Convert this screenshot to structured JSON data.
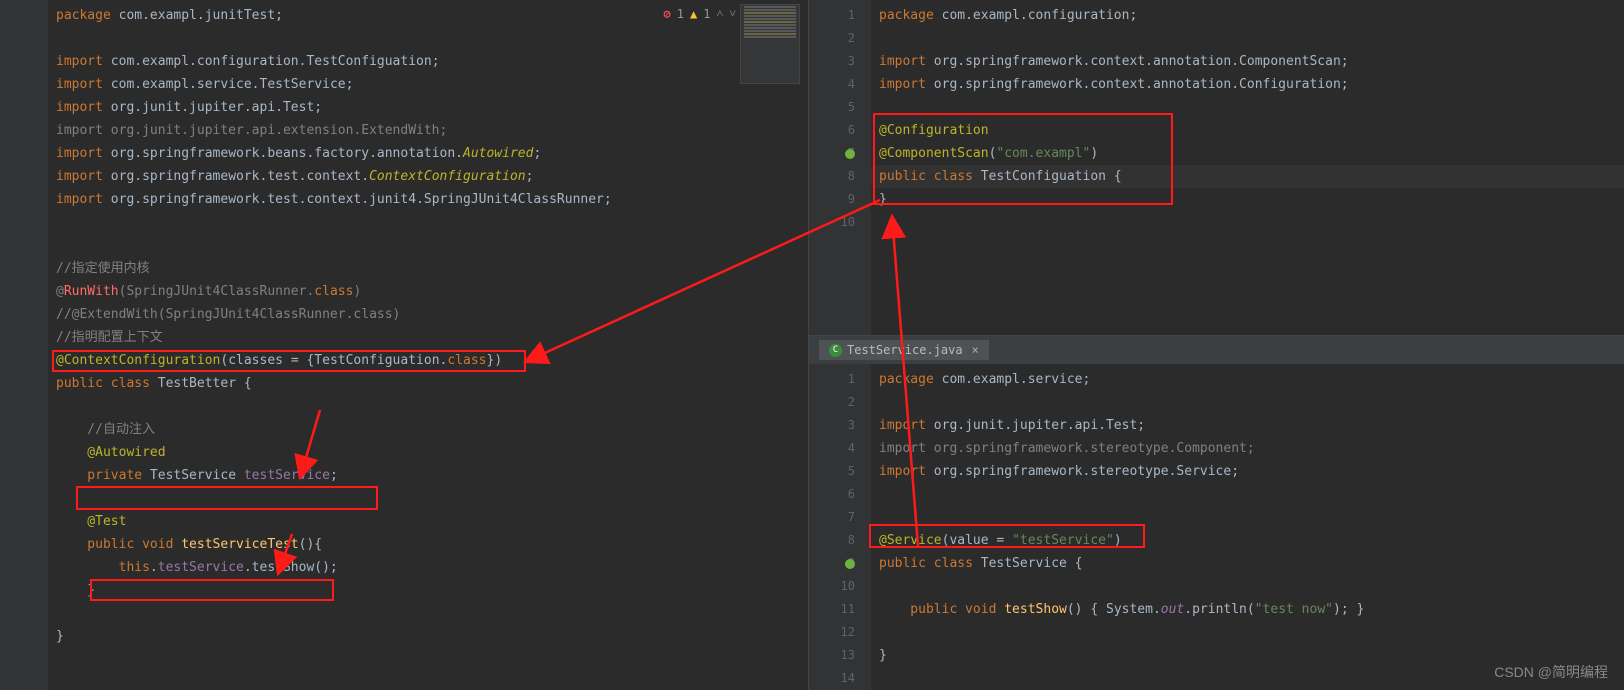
{
  "inspections": {
    "errors": "1",
    "warnings": "1"
  },
  "left": {
    "l1_kw1": "package",
    "l1_pkg": " com.exampl.junitTest;",
    "l3_kw": "import",
    "l3a": " com.exampl.configuration.TestConfiguation;",
    "l4_kw": "import",
    "l4a": " com.exampl.service.TestService;",
    "l5_kw": "import",
    "l5a": " org.junit.jupiter.api.Test;",
    "l6": "import org.junit.jupiter.api.extension.ExtendWith;",
    "l7_kw": "import",
    "l7a": " org.springframework.beans.factory.annotation.",
    "l7b": "Autowired",
    "l7c": ";",
    "l8_kw": "import",
    "l8a": " org.springframework.test.context.",
    "l8b": "ContextConfiguration",
    "l8c": ";",
    "l9_kw": "import",
    "l9a": " org.springframework.test.context.junit4.SpringJUnit4ClassRunner;",
    "c1": "//指定使用内核",
    "r1a": "@",
    "r1b": "RunWith",
    "r1c": "(SpringJUnit4ClassRunner.",
    "r1d": "class",
    "r1e": ")",
    "c2": "//@ExtendWith(SpringJUnit4ClassRunner.class)",
    "c3": "//指明配置上下文",
    "cc1": "@ContextConfiguration",
    "cc2": "(classes = {TestConfiguation.",
    "cc3": "class",
    "cc4": "})",
    "cls1": "public class ",
    "cls2": "TestBetter ",
    "cls3": "{",
    "c4": "    //自动注入",
    "aw": "    @Autowired",
    "pv1": "    private ",
    "pv2": "TestService ",
    "pv3": "testService",
    "pv4": ";",
    "t1": "    @Test",
    "m1": "    public void ",
    "m2": "testServiceTest",
    "m3": "(){",
    "b1": "        this",
    "b2": ".",
    "b3": "testService",
    "b4": ".testShow();",
    "cb1": "    }",
    "cb2": "}"
  },
  "rightTop": {
    "l1_kw": "package",
    "l1_pkg": " com.exampl.configuration;",
    "l3_kw": "import",
    "l3a": " org.springframework.context.annotation.ComponentScan;",
    "l4_kw": "import",
    "l4a": " org.springframework.context.annotation.Configuration;",
    "a1": "@Configuration",
    "a2a": "@ComponentScan",
    "a2b": "(",
    "a2c": "\"com.exampl\"",
    "a2d": ")",
    "c1": "public class ",
    "c2": "TestConfiguation ",
    "c3": "{",
    "cb": "}"
  },
  "tab": {
    "label": "TestService.java",
    "close": "×"
  },
  "rightBot": {
    "l1_kw": "package",
    "l1_pkg": " com.exampl.service;",
    "l3_kw": "import",
    "l3a": " org.junit.jupiter.api.Test;",
    "l4": "import org.springframework.stereotype.Component;",
    "l5_kw": "import",
    "l5a": " org.springframework.stereotype.Service;",
    "s1": "@Service",
    "s2": "(value = ",
    "s3": "\"testService\"",
    "s4": ")",
    "c1": "public class ",
    "c2": "TestService ",
    "c3": "{",
    "m1": "    public void ",
    "m2": "testShow",
    "m3": "() { System.",
    "m4": "out",
    "m5": ".println(",
    "m6": "\"test now\"",
    "m7": "); }",
    "cb": "}"
  },
  "watermark": "CSDN @简明编程"
}
